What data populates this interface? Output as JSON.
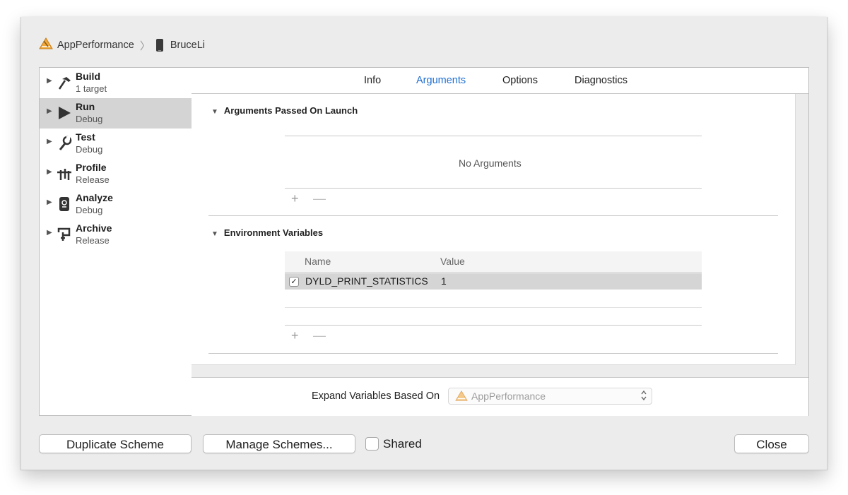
{
  "breadcrumb": {
    "project": "AppPerformance",
    "device": "BruceLi",
    "project_icon": "xcode-app-icon",
    "device_icon": "iphone-icon"
  },
  "sidebar": {
    "items": [
      {
        "title": "Build",
        "subtitle": "1 target",
        "icon": "hammer-icon",
        "selected": false
      },
      {
        "title": "Run",
        "subtitle": "Debug",
        "icon": "play-icon",
        "selected": true
      },
      {
        "title": "Test",
        "subtitle": "Debug",
        "icon": "wrench-icon",
        "selected": false
      },
      {
        "title": "Profile",
        "subtitle": "Release",
        "icon": "instruments-icon",
        "selected": false
      },
      {
        "title": "Analyze",
        "subtitle": "Debug",
        "icon": "analyze-icon",
        "selected": false
      },
      {
        "title": "Archive",
        "subtitle": "Release",
        "icon": "archive-icon",
        "selected": false
      }
    ]
  },
  "tabs": {
    "items": [
      "Info",
      "Arguments",
      "Options",
      "Diagnostics"
    ],
    "active": "Arguments",
    "active_color": "#1f6fd1"
  },
  "arguments": {
    "section_title": "Arguments Passed On Launch",
    "empty_text": "No Arguments",
    "add": "+",
    "remove": "—"
  },
  "environment": {
    "section_title": "Environment Variables",
    "columns": [
      "Name",
      "Value"
    ],
    "rows": [
      {
        "enabled": "✓",
        "name": "DYLD_PRINT_STATISTICS",
        "value": "1"
      }
    ],
    "add": "+",
    "remove": "—"
  },
  "expand": {
    "label": "Expand Variables Based On",
    "selected": "AppPerformance",
    "arrows": "⌃⌄"
  },
  "footer": {
    "duplicate": "Duplicate Scheme",
    "manage": "Manage Schemes...",
    "shared": "Shared",
    "close": "Close"
  }
}
